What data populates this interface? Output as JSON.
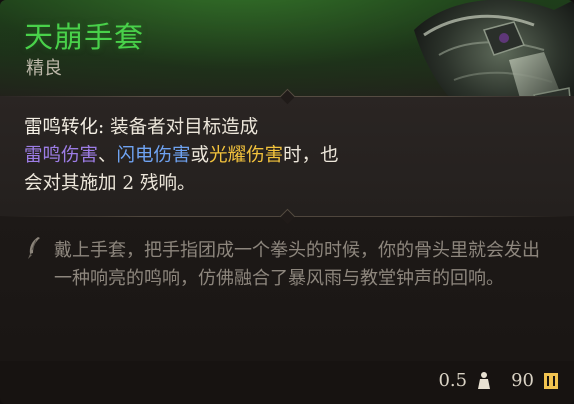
{
  "item": {
    "name": "天崩手套",
    "rarity": "精良"
  },
  "passive": {
    "name": "雷鸣转化:",
    "line1_rest": " 装备者对目标造成",
    "dmg_thunder": "雷鸣伤害",
    "sep1": "、",
    "dmg_lightning": "闪电伤害",
    "conj": "或",
    "dmg_radiant": "光耀伤害",
    "line2_rest": "时，也",
    "line3": "会对其施加 2 残响。",
    "colors": {
      "thunder": "#9d7de6",
      "lightning": "#6fa3f2",
      "radiant": "#f2c23c"
    }
  },
  "lore": {
    "icon": "quill-icon",
    "text": "戴上手套，把手指团成一个拳头的时候，你的骨头里就会发出一种响亮的鸣响，仿佛融合了暴风雨与教堂钟声的回响。"
  },
  "footer": {
    "weight": "0.5",
    "weight_icon": "weight-icon",
    "value": "90",
    "value_icon": "gold-coin-icon"
  },
  "colors": {
    "rarity_green": "#49d14a",
    "header_glow": "#3e8c30"
  }
}
